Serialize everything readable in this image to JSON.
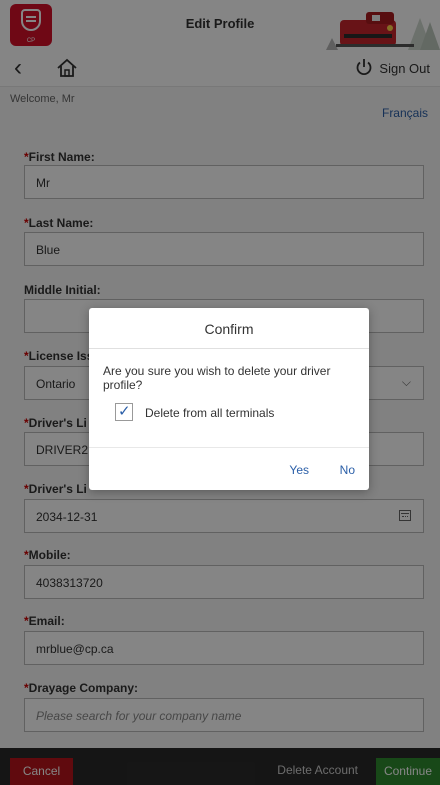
{
  "header": {
    "logo_text": "CP",
    "title": "Edit Profile"
  },
  "nav": {
    "sign_out": "Sign Out"
  },
  "welcome": "Welcome, Mr",
  "language_link": "Français",
  "form": {
    "first_name": {
      "label": "First Name:",
      "value": "Mr"
    },
    "last_name": {
      "label": "Last Name:",
      "value": "Blue"
    },
    "middle_initial": {
      "label": "Middle Initial:",
      "value": ""
    },
    "license_issued": {
      "label": "License Iss",
      "value": "Ontario"
    },
    "drivers_license": {
      "label": "Driver's Li",
      "value": "DRIVER2"
    },
    "license_expiry": {
      "label": "Driver's Li",
      "value": "2034-12-31"
    },
    "mobile": {
      "label": "Mobile:",
      "value": "4038313720"
    },
    "email": {
      "label": "Email:",
      "value": "mrblue@cp.ca"
    },
    "drayage": {
      "label": "Drayage Company:",
      "placeholder": "Please search for your company name"
    }
  },
  "footer": {
    "cancel": "Cancel",
    "delete": "Delete Account",
    "continue": "Continue"
  },
  "dialog": {
    "title": "Confirm",
    "message": "Are you sure you wish to delete your driver profile?",
    "checkbox_label": "Delete from all terminals",
    "checkbox_checked": true,
    "yes": "Yes",
    "no": "No"
  },
  "colors": {
    "brand_red": "#d5102a",
    "link_blue": "#2b5fa8",
    "continue_green": "#2e8b2e",
    "cancel_red": "#b8151b"
  }
}
